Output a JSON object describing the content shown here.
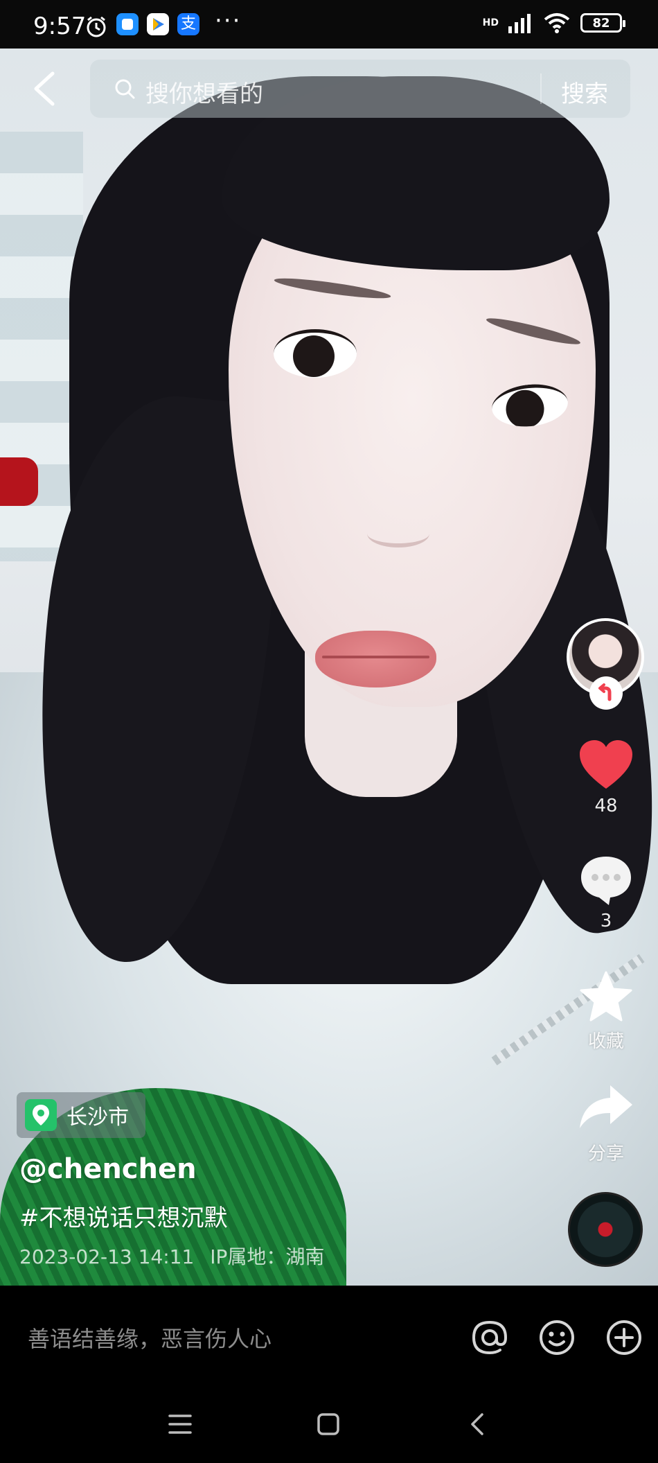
{
  "status_bar": {
    "time": "9:57",
    "battery": "82",
    "network": "HD"
  },
  "search": {
    "placeholder": "搜你想看的",
    "button_label": "搜索"
  },
  "actions": {
    "likes": "48",
    "comments": "3",
    "favorite_label": "收藏",
    "share_label": "分享"
  },
  "post": {
    "location": "长沙市",
    "username": "@chenchen",
    "caption": "#不想说话只想沉默",
    "timestamp": "2023-02-13 14:11",
    "ip_location": "IP属地：湖南"
  },
  "comment_bar": {
    "placeholder": "善语结善缘，恶言伤人心"
  },
  "colors": {
    "like_red": "#f0404f",
    "location_green": "#25c26a",
    "background": "#000000"
  }
}
